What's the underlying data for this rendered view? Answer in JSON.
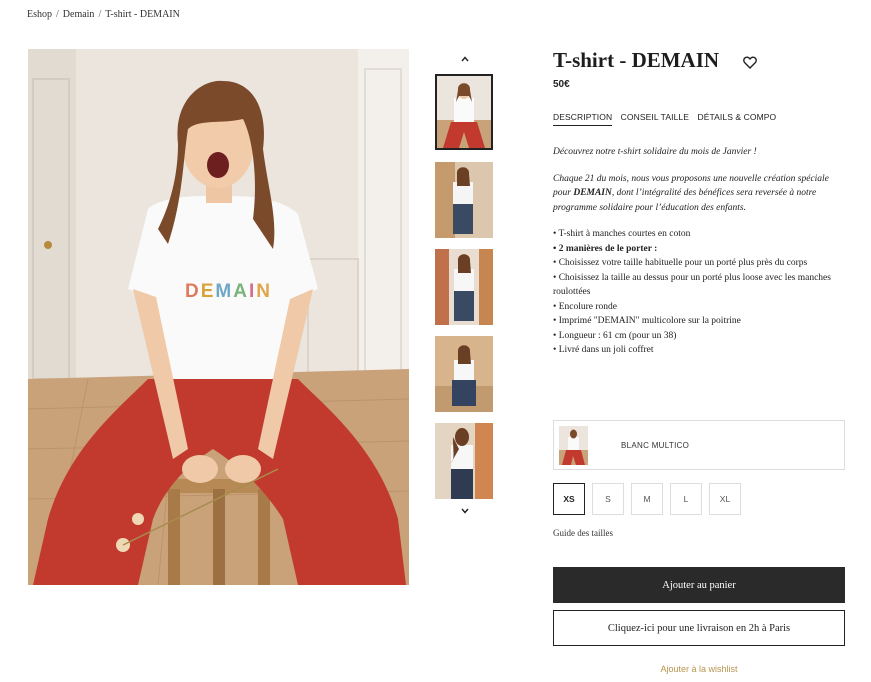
{
  "breadcrumb": {
    "items": [
      "Eshop",
      "Demain",
      "T-shirt - DEMAIN"
    ],
    "separator": "/"
  },
  "product": {
    "title": "T-shirt - DEMAIN",
    "price": "50€",
    "tabs": [
      {
        "label": "DESCRIPTION",
        "active": true
      },
      {
        "label": "CONSEIL TAILLE",
        "active": false
      },
      {
        "label": "DÉTAILS & COMPO",
        "active": false
      }
    ],
    "description": {
      "intro": "Découvrez notre t-shirt solidaire du mois de Janvier !",
      "para_pre": "Chaque 21 du mois, nous vous proposons une nouvelle création spéciale pour ",
      "para_bold": "DEMAIN",
      "para_post": ", dont l’intégralité des bénéfices sera reversée à notre programme solidaire pour l’éducation des enfants.",
      "bullets": [
        "• T-shirt à manches courtes en coton",
        "• 2 manières de le porter :",
        "• Choisissez votre taille habituelle pour un porté plus près du corps",
        "• Choisissez la taille au dessus pour un porté plus loose avec les manches roulottées",
        "• Encolure ronde",
        "• Imprimé \"DEMAIN\" multicolore sur la poitrine",
        "• Longueur : 61 cm (pour un 38)",
        "• Livré dans un joli coffret"
      ]
    },
    "color": "BLANC MULTICO",
    "sizes": [
      {
        "label": "XS",
        "selected": true
      },
      {
        "label": "S",
        "selected": false
      },
      {
        "label": "M",
        "selected": false
      },
      {
        "label": "L",
        "selected": false
      },
      {
        "label": "XL",
        "selected": false
      }
    ],
    "size_guide": "Guide des tailles",
    "add_to_cart": "Ajouter au panier",
    "express_delivery": "Cliquez-ici pour une livraison en 2h à Paris",
    "wishlist": "Ajouter à la wishlist"
  },
  "image": {
    "tshirt_print": "DEMAIN",
    "tshirt_print_colors": [
      "#e07a5f",
      "#d9a23b",
      "#6fa8c7",
      "#7ab37a",
      "#d56f8f",
      "#e0a64b"
    ]
  },
  "icons": {
    "heart": "heart-icon",
    "thumb_up": "chevron-up-icon",
    "thumb_down": "chevron-down-icon"
  },
  "colors": {
    "primary_button": "#2a2a2a",
    "wishlist_link": "#b8954f",
    "pants": "#c23a2e"
  }
}
